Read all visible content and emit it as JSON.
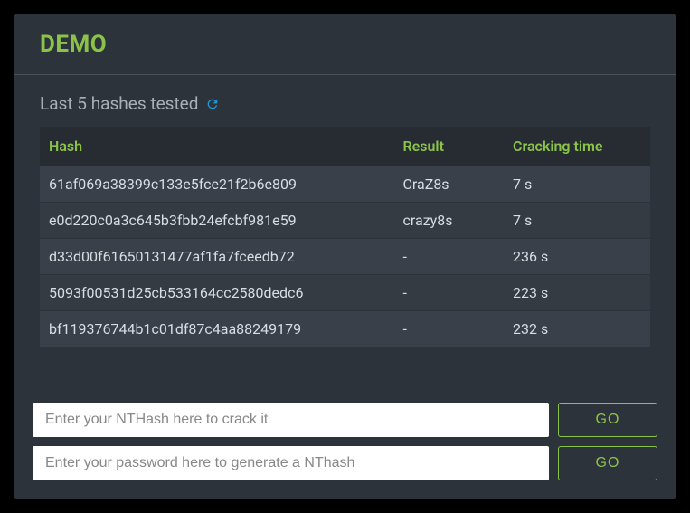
{
  "header": {
    "title": "DEMO"
  },
  "subheader": {
    "label": "Last 5 hashes tested"
  },
  "table": {
    "columns": {
      "hash": "Hash",
      "result": "Result",
      "time": "Cracking time"
    },
    "rows": [
      {
        "hash": "61af069a38399c133e5fce21f2b6e809",
        "result": "CraZ8s",
        "time": "7 s"
      },
      {
        "hash": "e0d220c0a3c645b3fbb24efcbf981e59",
        "result": "crazy8s",
        "time": "7 s"
      },
      {
        "hash": "d33d00f61650131477af1fa7fceedb72",
        "result": "-",
        "time": "236 s"
      },
      {
        "hash": "5093f00531d25cb533164cc2580dedc6",
        "result": "-",
        "time": "223 s"
      },
      {
        "hash": "bf119376744b1c01df87c4aa88249179",
        "result": "-",
        "time": "232 s"
      }
    ]
  },
  "forms": {
    "crack": {
      "placeholder": "Enter your NTHash here to crack it",
      "button": "GO"
    },
    "generate": {
      "placeholder": "Enter your password here to generate a NThash",
      "button": "GO"
    }
  }
}
